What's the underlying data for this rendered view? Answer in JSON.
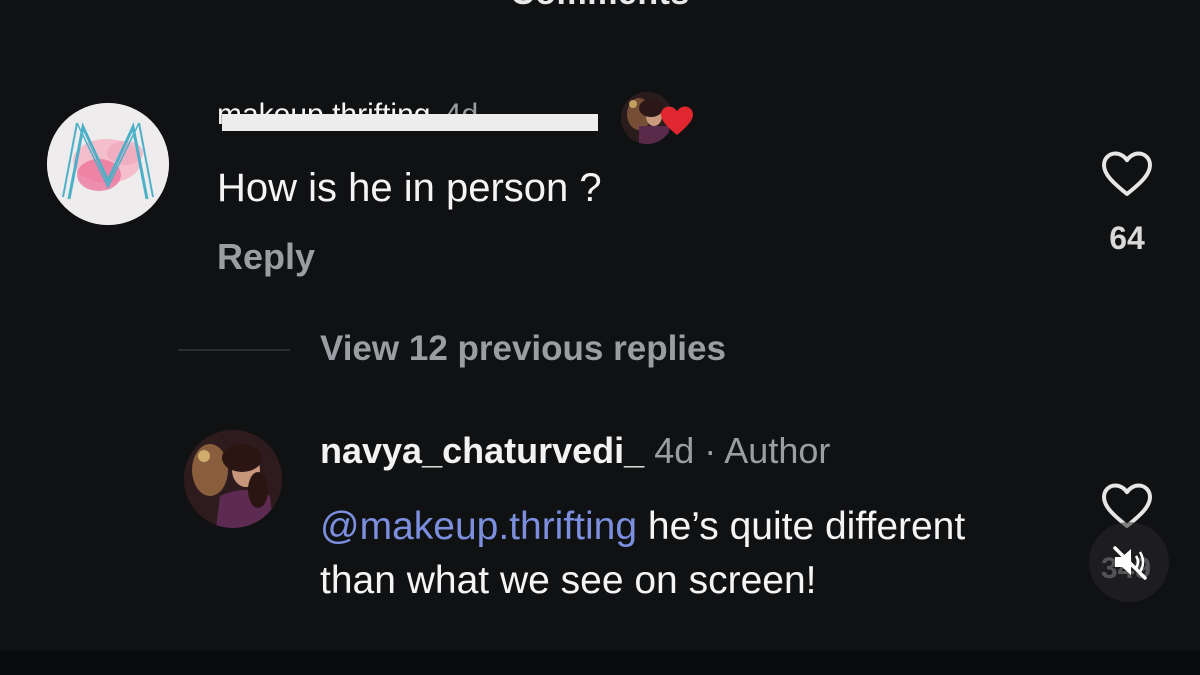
{
  "header": {
    "title": "Comments"
  },
  "comments": [
    {
      "username": "makeup.thrifting",
      "time": "4d",
      "text": "How is he in person ?",
      "reply_label": "Reply",
      "likes": "64",
      "avatar_letter": "M",
      "reacted_by_author": true,
      "like_icon": "heart-outline-icon",
      "reaction_icon": "heart-filled-icon",
      "reaction_color": "#e0262f"
    }
  ],
  "replies": {
    "view_label": "View 12 previous replies"
  },
  "reply": {
    "username": "navya_chaturvedi_",
    "time": "4d",
    "separator": "·",
    "badge": "Author",
    "mention": "@makeup.thrifting",
    "text": " he’s quite different than what we see on screen!",
    "likes": "349",
    "like_icon": "heart-outline-icon",
    "mention_color": "#7b8fde"
  },
  "overlay": {
    "mute_icon": "speaker-muted-icon"
  }
}
